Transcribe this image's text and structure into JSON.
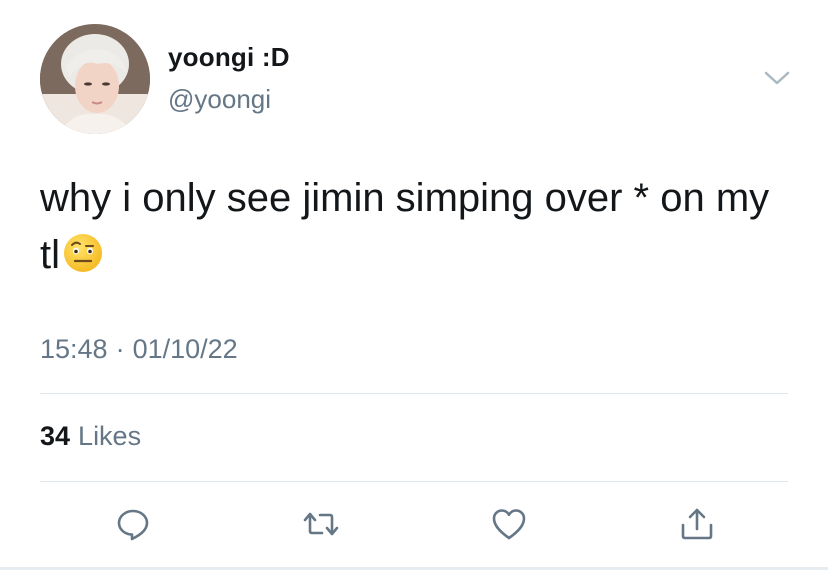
{
  "tweet": {
    "display_name": "yoongi :D",
    "handle": "@yoongi",
    "text": "why i only see jimin simping over * on my tl",
    "emoji": "raised-eyebrow-emoji",
    "time": "15:48",
    "separator": "·",
    "date": "01/10/22",
    "likes_count": "34",
    "likes_label": "Likes"
  },
  "icons": {
    "menu": "chevron-down-icon",
    "reply": "reply-icon",
    "retweet": "retweet-icon",
    "like": "heart-icon",
    "share": "share-icon"
  },
  "colors": {
    "text_primary": "#14171a",
    "text_secondary": "#657786",
    "icon": "#657786",
    "divider": "#e1e8ed"
  }
}
